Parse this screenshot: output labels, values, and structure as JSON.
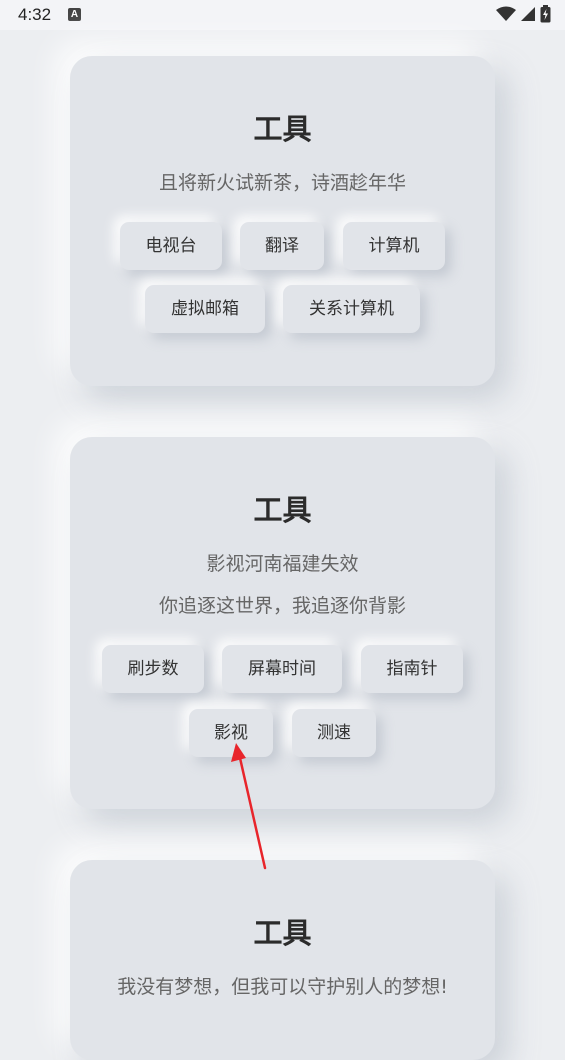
{
  "status": {
    "time": "4:32",
    "a_icon_letter": "A",
    "icons": [
      "wifi-icon",
      "signal-icon",
      "battery-charging-icon"
    ]
  },
  "cards": [
    {
      "title": "工具",
      "subtitles": [
        "且将新火试新茶，诗酒趁年华"
      ],
      "buttons": [
        "电视台",
        "翻译",
        "计算机",
        "虚拟邮箱",
        "关系计算机"
      ]
    },
    {
      "title": "工具",
      "subtitles": [
        "影视河南福建失效",
        "你追逐这世界，我追逐你背影"
      ],
      "buttons": [
        "刷步数",
        "屏幕时间",
        "指南针",
        "影视",
        "测速"
      ]
    },
    {
      "title": "工具",
      "subtitles": [
        "我没有梦想，但我可以守护别人的梦想!"
      ],
      "buttons": []
    }
  ],
  "colors": {
    "background": "#eceef1",
    "card": "#e1e4e9",
    "annotation_arrow": "#e8252b"
  }
}
